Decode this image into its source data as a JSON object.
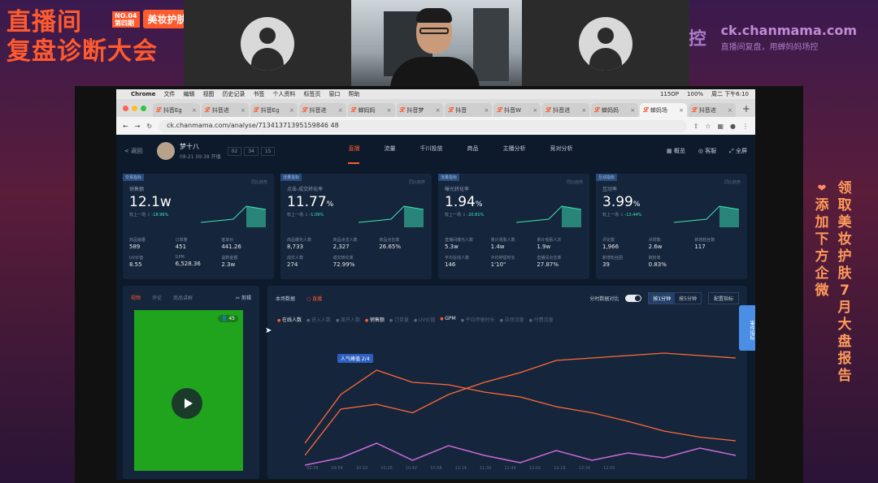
{
  "banner": {
    "title_line1": "直播间",
    "title_line2": "复盘诊断大会",
    "tag_no": "NO.04",
    "tag_no_sub": "第四期",
    "tag_text": "美妆护肤专",
    "ctrl": "场控",
    "site": "ck.chanmama.com",
    "site_sub": "直播间复盘，用蝉妈妈场控",
    "promo_col1": "领取美妆护肤7月大盘报告",
    "promo_col2": "添加下方企微"
  },
  "mac_menu": {
    "items": [
      "Chrome",
      "文件",
      "编辑",
      "视图",
      "历史记录",
      "书签",
      "个人资料",
      "标签页",
      "窗口",
      "帮助"
    ],
    "status": "周二 下午6:10",
    "battery": "100%",
    "wifi_speed": "115OP"
  },
  "browser": {
    "tabs": [
      "抖音Eg",
      "抖音进",
      "抖音Eg",
      "抖音进",
      "蝉妈妈",
      "抖音梦",
      "抖音",
      "抖音W",
      "抖音进",
      "蝉妈妈",
      "蝉妈场",
      "抖音进"
    ],
    "active_tab_index": 10,
    "url": "ck.chanmama.com/analyse/71341371395159846 48"
  },
  "app": {
    "back": "< 返回",
    "anchor_name": "梦十八",
    "anchor_time": "08-21 09:38 开播",
    "time_boxes": [
      "02",
      "34",
      "15"
    ],
    "nav_tabs": [
      "直播",
      "流量",
      "千川投放",
      "商品",
      "主播分析",
      "竞对分析"
    ],
    "nav_active": 0,
    "actions": [
      "概览",
      "客服",
      "全屏"
    ],
    "cards": [
      {
        "label": "交易指标",
        "caption": "销售额",
        "value": "12.1w",
        "unit": "",
        "cmp": "较上一场",
        "delta": "-18.96%",
        "trend": "同比趋势",
        "stats": [
          [
            "商品销量",
            "589"
          ],
          [
            "订单量",
            "451"
          ],
          [
            "客单价",
            "441.26"
          ],
          [
            "UV价值",
            "8.55"
          ],
          [
            "GPM",
            "6,528.36"
          ],
          [
            "退款金额",
            "2.3w"
          ]
        ]
      },
      {
        "label": "流量指标",
        "caption": "点击-成交转化率",
        "value": "11.77",
        "unit": "%",
        "cmp": "较上一场",
        "delta": "-1.09%",
        "trend": "同比趋势",
        "stats": [
          [
            "商品曝光人数",
            "8,733"
          ],
          [
            "商品点击人数",
            "2,327"
          ],
          [
            "商品点击率",
            "26.65%"
          ],
          [
            "成交人数",
            "274"
          ],
          [
            "成交转化率",
            "72.99%"
          ],
          [
            "",
            ""
          ]
        ]
      },
      {
        "label": "流量指标",
        "caption": "曝光转化率",
        "value": "1.94",
        "unit": "%",
        "cmp": "较上一场",
        "delta": "-20.81%",
        "trend": "同比趋势",
        "stats": [
          [
            "直播间曝光人数",
            "5.3w"
          ],
          [
            "累计观看人数",
            "1.4w"
          ],
          [
            "累计观看人次",
            "1.9w"
          ],
          [
            "平均在线人数",
            "146"
          ],
          [
            "平均停留时长",
            "1'10\""
          ],
          [
            "直播间点击率",
            "27.87%"
          ]
        ]
      },
      {
        "label": "互动指标",
        "caption": "互动率",
        "value": "3.99",
        "unit": "%",
        "cmp": "较上一场",
        "delta": "-13.44%",
        "trend": "同比趋势",
        "stats": [
          [
            "评论数",
            "1,966"
          ],
          [
            "点赞数",
            "2.6w"
          ],
          [
            "新增粉丝数",
            "117"
          ],
          [
            "新增粉丝团",
            "39"
          ],
          [
            "转粉率",
            "0.83%"
          ],
          [
            "",
            ""
          ]
        ]
      }
    ],
    "video": {
      "tabs": [
        "视频",
        "评论",
        "商品讲解"
      ],
      "clip": "剪辑",
      "viewers": "45"
    },
    "chart_panel": {
      "title": "本场数据",
      "tag": "直播",
      "compare": "分时数据对比",
      "seg_on": "按1分钟",
      "seg_off": "按5分钟",
      "config": "配置指标",
      "side": "事件指标",
      "metrics": [
        {
          "name": "在线人数",
          "on": true
        },
        {
          "name": "进入人数",
          "on": false
        },
        {
          "name": "离开人数",
          "on": false
        },
        {
          "name": "销售额",
          "on": true
        },
        {
          "name": "订单量",
          "on": false
        },
        {
          "name": "UV价值",
          "on": false
        },
        {
          "name": "GPM",
          "on": true
        },
        {
          "name": "平均停留时长",
          "on": false
        },
        {
          "name": "自然流量",
          "on": false
        },
        {
          "name": "付费流量",
          "on": false
        }
      ],
      "peak": "人气峰值 2/4",
      "xticks": [
        "09:38",
        "09:54",
        "10:10",
        "10:26",
        "10:42",
        "10:58",
        "11:14",
        "11:30",
        "11:46",
        "12:02",
        "12:18",
        "12:34",
        "12:50"
      ]
    }
  },
  "colors": {
    "accent": "#ff5a2e",
    "teal": "#3ee6b8",
    "line_orange": "#ff6a3a",
    "line_purple": "#c86ad8"
  },
  "chart_data": {
    "type": "line",
    "x": [
      "09:38",
      "09:54",
      "10:10",
      "10:26",
      "10:42",
      "10:58",
      "11:14",
      "11:30",
      "11:46",
      "12:02",
      "12:18",
      "12:34",
      "12:50"
    ],
    "series": [
      {
        "name": "在线人数",
        "values": [
          10,
          48,
          52,
          45,
          60,
          70,
          78,
          88,
          90,
          92,
          94,
          92,
          90
        ]
      },
      {
        "name": "销售额",
        "values": [
          20,
          60,
          80,
          70,
          68,
          62,
          58,
          50,
          45,
          38,
          30,
          25,
          22
        ]
      },
      {
        "name": "GPM",
        "values": [
          2,
          8,
          20,
          6,
          18,
          10,
          4,
          14,
          6,
          12,
          8,
          16,
          10
        ]
      }
    ]
  }
}
